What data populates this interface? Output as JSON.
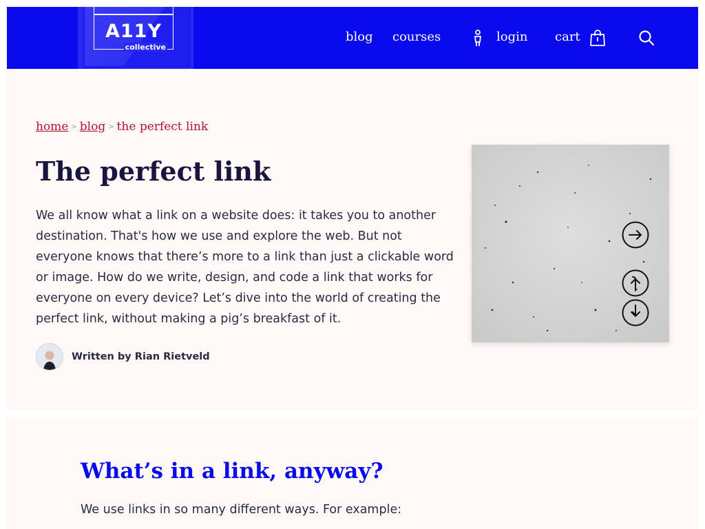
{
  "header": {
    "logo_main": "A11Y",
    "logo_sub": "collective",
    "nav": {
      "blog": "blog",
      "courses": "courses",
      "login": "login",
      "cart": "cart"
    },
    "icons": [
      "person-icon",
      "shopping-bag-icon",
      "search-icon"
    ],
    "background_color": "#0a0aee"
  },
  "breadcrumb": {
    "home": "home",
    "blog": "blog",
    "current": "the perfect link",
    "separator": ">"
  },
  "article": {
    "title": "The perfect link",
    "intro": "We all know what a link on a website does: it takes you to another destination. That's how we use and explore the web. But not everyone knows that there’s more to a link than just a clickable word or image. How do we write, design, and code a link that works for everyone on every device? Let’s dive into the world of creating the perfect link, without making a pig’s breakfast of it.",
    "author": "Written by Rian Rietveld",
    "image_icons": [
      "arrow-right-circle-icon",
      "arrow-up-circle-icon",
      "arrow-down-circle-icon"
    ]
  },
  "section": {
    "heading": "What’s in a link, anyway?",
    "paragraph": "We use links in so many different ways. For example:"
  },
  "colors": {
    "accent": "#0a0aee",
    "link_red": "#b3122e",
    "page_bg": "#fff9f7",
    "text": "#2a2a44"
  }
}
